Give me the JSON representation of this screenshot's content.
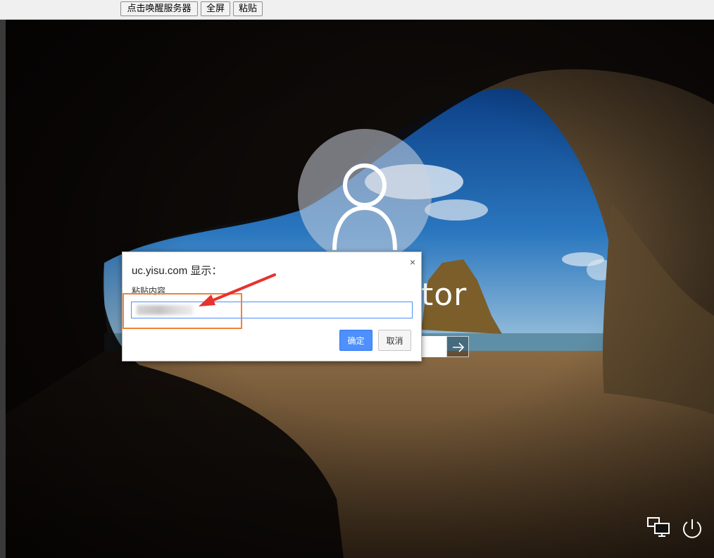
{
  "toolbar": {
    "wake_label": "点击唤醒服务器",
    "fullscreen_label": "全屏",
    "paste_label": "粘贴"
  },
  "login": {
    "username_partial": "tor"
  },
  "dialog": {
    "title": "uc.yisu.com 显示：",
    "label": "粘贴内容",
    "input_value": "",
    "ok_label": "确定",
    "cancel_label": "取消",
    "close_glyph": "×"
  },
  "colors": {
    "accent": "#4d90fe",
    "highlight": "#f0823a",
    "arrow": "#e8322e"
  }
}
